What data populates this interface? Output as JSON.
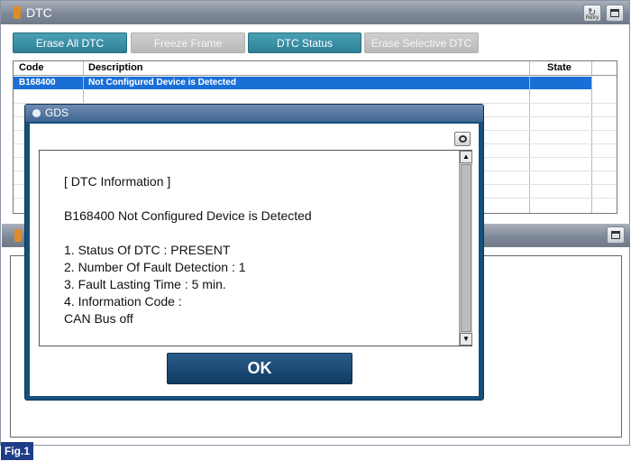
{
  "window": {
    "title": "DTC",
    "retry_label": "Retry"
  },
  "toolbar": {
    "buttons": [
      {
        "label": "Erase All DTC",
        "state": "active"
      },
      {
        "label": "Freeze Frame",
        "state": "disabled"
      },
      {
        "label": "DTC Status",
        "state": "active"
      },
      {
        "label": "Erase Selective DTC",
        "state": "disabled"
      }
    ]
  },
  "table": {
    "headers": {
      "code": "Code",
      "description": "Description",
      "state": "State"
    },
    "rows": [
      {
        "code": "B168400",
        "description": "Not Configured Device is Detected",
        "state": "",
        "selected": true
      }
    ]
  },
  "dialog": {
    "title": "GDS",
    "heading": "[ DTC Information ]",
    "dtc_line": "B168400 Not Configured Device is Detected",
    "items": [
      "1. Status Of DTC : PRESENT",
      "2. Number Of Fault Detection : 1",
      "3. Fault Lasting Time : 5 min.",
      "4. Information Code :",
      "CAN Bus off"
    ],
    "ok_label": "OK"
  },
  "figure_label": "Fig.1",
  "colors": {
    "selected_row": "#1a6fd6",
    "active_button": "#2e8197",
    "dialog_frame": "#15507a",
    "fig_label_bg": "#1f3c88"
  }
}
